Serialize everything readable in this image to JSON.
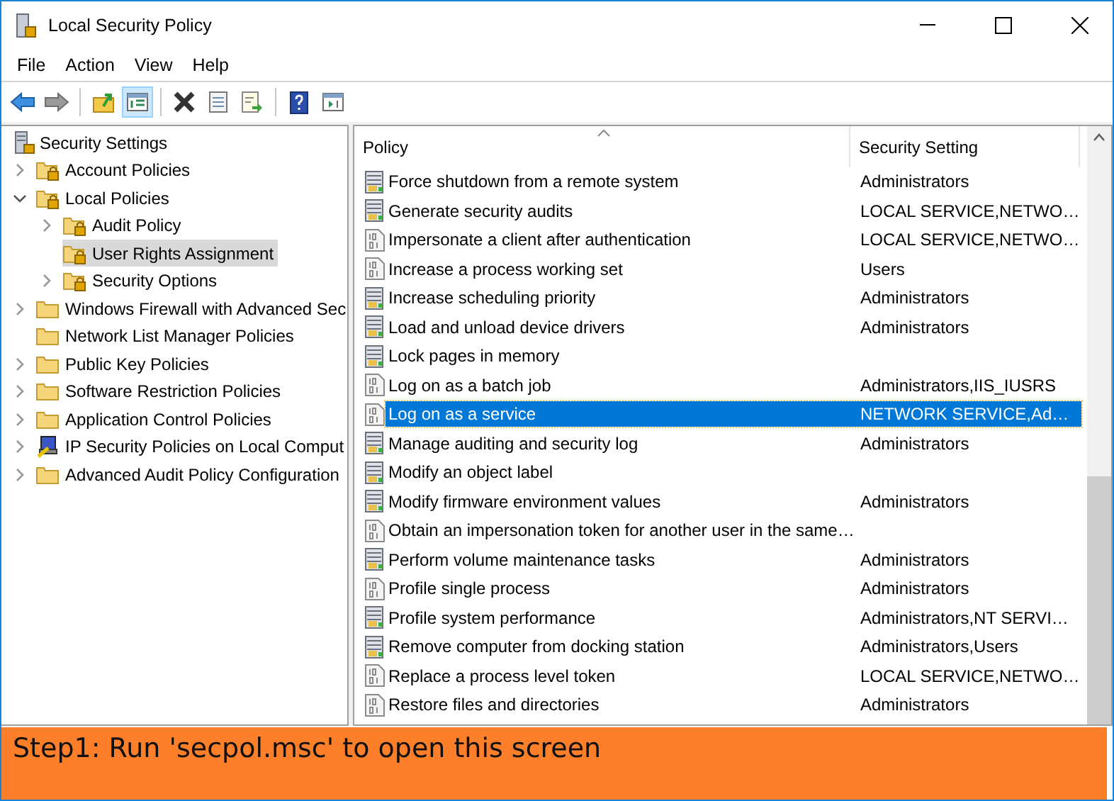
{
  "window": {
    "title": "Local Security Policy"
  },
  "menu": [
    "File",
    "Action",
    "View",
    "Help"
  ],
  "toolbar": [
    [
      {
        "kind": "back",
        "selected": false
      },
      {
        "kind": "forward",
        "selected": false
      }
    ],
    [
      {
        "kind": "up",
        "selected": false
      },
      {
        "kind": "tree",
        "selected": true
      }
    ],
    [
      {
        "kind": "delete",
        "selected": false
      },
      {
        "kind": "properties",
        "selected": false
      },
      {
        "kind": "export",
        "selected": false
      }
    ],
    [
      {
        "kind": "help",
        "selected": false
      },
      {
        "kind": "pane",
        "selected": false
      }
    ]
  ],
  "tree": [
    {
      "label": "Security Settings",
      "kind": "server",
      "selected": false,
      "children": [
        {
          "label": "Account Policies",
          "kind": "lockfolder",
          "expanded": false,
          "selected": false
        },
        {
          "label": "Local Policies",
          "kind": "lockfolder",
          "expanded": true,
          "selected": false,
          "children": [
            {
              "label": "Audit Policy",
              "kind": "lockfolder",
              "expanded": false,
              "selected": false
            },
            {
              "label": "User Rights Assignment",
              "kind": "lockfolder",
              "selected": true
            },
            {
              "label": "Security Options",
              "kind": "lockfolder",
              "expanded": false,
              "selected": false
            }
          ]
        },
        {
          "label": "Windows Firewall with Advanced Sec",
          "kind": "folder",
          "expanded": false,
          "selected": false
        },
        {
          "label": "Network List Manager Policies",
          "kind": "folder",
          "selected": false
        },
        {
          "label": "Public Key Policies",
          "kind": "folder",
          "expanded": false,
          "selected": false
        },
        {
          "label": "Software Restriction Policies",
          "kind": "folder",
          "expanded": false,
          "selected": false
        },
        {
          "label": "Application Control Policies",
          "kind": "folder",
          "expanded": false,
          "selected": false
        },
        {
          "label": "IP Security Policies on Local Comput",
          "kind": "computer",
          "expanded": false,
          "selected": false
        },
        {
          "label": "Advanced Audit Policy Configuration",
          "kind": "folder",
          "expanded": false,
          "selected": false
        }
      ]
    }
  ],
  "list": {
    "columns": [
      "Policy",
      "Security Setting"
    ],
    "rows": [
      {
        "policy": "Force shutdown from a remote system",
        "setting": "Administrators",
        "kind": "server",
        "selected": false
      },
      {
        "policy": "Generate security audits",
        "setting": "LOCAL SERVICE,NETWO…",
        "kind": "server",
        "selected": false
      },
      {
        "policy": "Impersonate a client after authentication",
        "setting": "LOCAL SERVICE,NETWO…",
        "kind": "binary",
        "selected": false
      },
      {
        "policy": "Increase a process working set",
        "setting": "Users",
        "kind": "binary",
        "selected": false
      },
      {
        "policy": "Increase scheduling priority",
        "setting": "Administrators",
        "kind": "server",
        "selected": false
      },
      {
        "policy": "Load and unload device drivers",
        "setting": "Administrators",
        "kind": "server",
        "selected": false
      },
      {
        "policy": "Lock pages in memory",
        "kind": "server",
        "selected": false
      },
      {
        "policy": "Log on as a batch job",
        "setting": "Administrators,IIS_IUSRS",
        "kind": "binary",
        "selected": false
      },
      {
        "policy": "Log on as a service",
        "setting": "NETWORK SERVICE,Ad…",
        "kind": "binary",
        "selected": true
      },
      {
        "policy": "Manage auditing and security log",
        "setting": "Administrators",
        "kind": "server",
        "selected": false
      },
      {
        "policy": "Modify an object label",
        "kind": "server",
        "selected": false
      },
      {
        "policy": "Modify firmware environment values",
        "setting": "Administrators",
        "kind": "server",
        "selected": false
      },
      {
        "policy": "Obtain an impersonation token for another user in the same…",
        "kind": "binary",
        "selected": false
      },
      {
        "policy": "Perform volume maintenance tasks",
        "setting": "Administrators",
        "kind": "server",
        "selected": false
      },
      {
        "policy": "Profile single process",
        "setting": "Administrators",
        "kind": "binary",
        "selected": false
      },
      {
        "policy": "Profile system performance",
        "setting": "Administrators,NT SERVI…",
        "kind": "server",
        "selected": false
      },
      {
        "policy": "Remove computer from docking station",
        "setting": "Administrators,Users",
        "kind": "server",
        "selected": false
      },
      {
        "policy": "Replace a process level token",
        "setting": "LOCAL SERVICE,NETWO…",
        "kind": "binary",
        "selected": false
      },
      {
        "policy": "Restore files and directories",
        "setting": "Administrators",
        "kind": "binary",
        "selected": false
      }
    ]
  },
  "banner": {
    "text": "Step1: Run 'secpol.msc' to open this screen"
  }
}
